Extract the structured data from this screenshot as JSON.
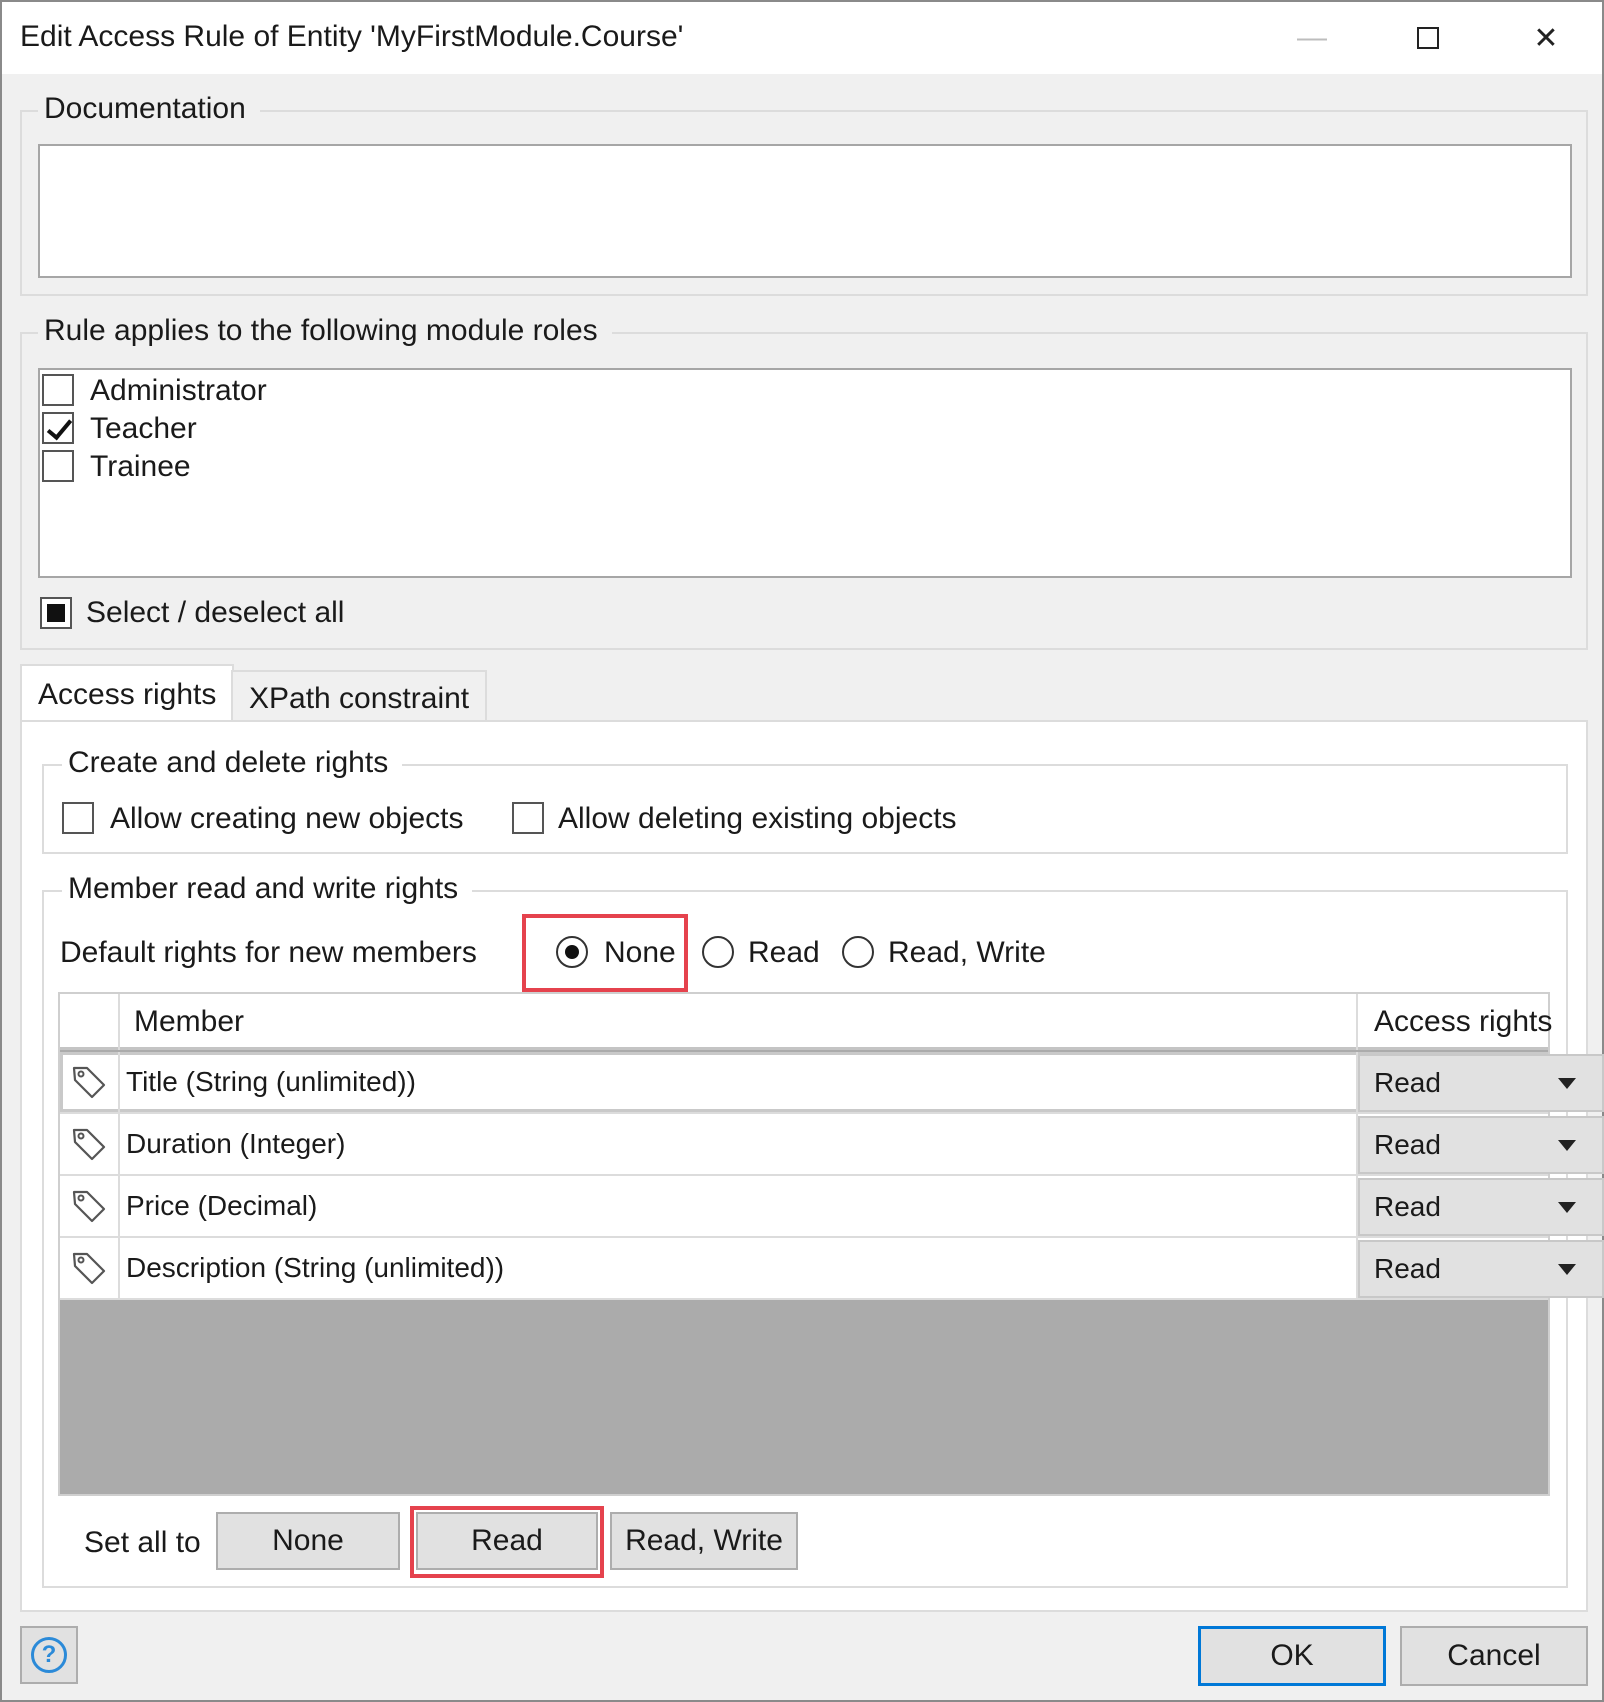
{
  "window": {
    "title": "Edit Access Rule of Entity 'MyFirstModule.Course'",
    "minimize": "—",
    "close": "✕"
  },
  "documentation": {
    "label": "Documentation",
    "value": ""
  },
  "roles": {
    "label": "Rule applies to the following module roles",
    "items": [
      {
        "label": "Administrator",
        "checked": false
      },
      {
        "label": "Teacher",
        "checked": true
      },
      {
        "label": "Trainee",
        "checked": false
      }
    ],
    "select_all_label": "Select / deselect all"
  },
  "tabs": [
    {
      "label": "Access rights",
      "active": true
    },
    {
      "label": "XPath constraint",
      "active": false
    }
  ],
  "create_delete": {
    "label": "Create and delete rights",
    "allow_create_label": "Allow creating new objects",
    "allow_delete_label": "Allow deleting existing objects"
  },
  "member_rights": {
    "label": "Member read and write rights",
    "default_label": "Default rights for new members",
    "options": [
      "None",
      "Read",
      "Read, Write"
    ],
    "selected": "None",
    "columns": {
      "member": "Member",
      "access": "Access rights"
    },
    "rows": [
      {
        "member": "Title (String (unlimited))",
        "access": "Read"
      },
      {
        "member": "Duration (Integer)",
        "access": "Read"
      },
      {
        "member": "Price (Decimal)",
        "access": "Read"
      },
      {
        "member": "Description (String (unlimited))",
        "access": "Read"
      }
    ],
    "set_all_label": "Set all to",
    "set_all_buttons": [
      "None",
      "Read",
      "Read, Write"
    ]
  },
  "footer": {
    "help": "?",
    "ok": "OK",
    "cancel": "Cancel"
  },
  "colors": {
    "highlight": "#e5424d",
    "accent": "#0078d7"
  }
}
